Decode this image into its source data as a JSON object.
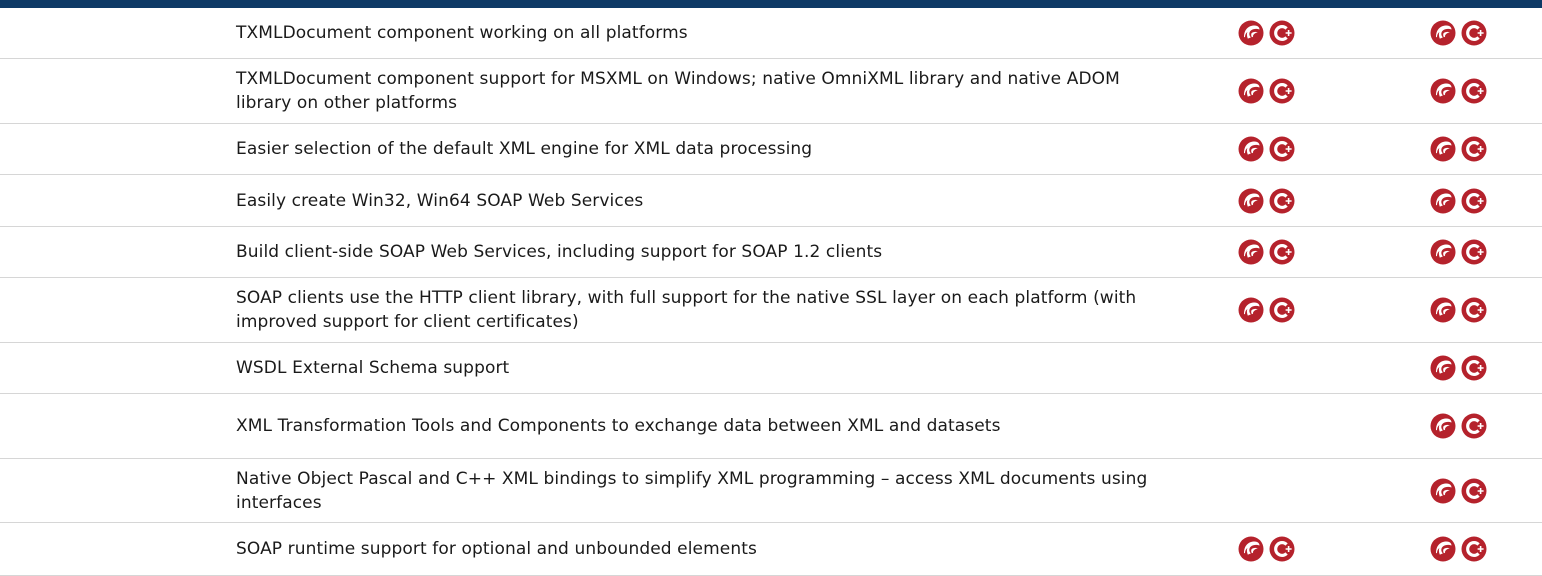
{
  "header": {
    "bar_color": "#0e3a66"
  },
  "icons": {
    "delphi": "delphi-helmet-icon",
    "cpp": "cpp-builder-icon",
    "color": "#b5222c"
  },
  "rows": [
    {
      "text": "TXMLDocument component working on all platforms",
      "col1": true,
      "col2": true
    },
    {
      "text": "TXMLDocument component support for MSXML on Windows; native OmniXML library and native ADOM library on other platforms",
      "col1": true,
      "col2": true
    },
    {
      "text": "Easier selection of the default XML engine for XML data processing",
      "col1": true,
      "col2": true
    },
    {
      "text": "Easily create Win32, Win64 SOAP Web Services",
      "col1": true,
      "col2": true
    },
    {
      "text": "Build client-side SOAP Web Services, including support for SOAP 1.2 clients",
      "col1": true,
      "col2": true
    },
    {
      "text": "SOAP clients use the HTTP client library, with full support for the native SSL layer on each platform (with improved support for client certificates)",
      "col1": true,
      "col2": true
    },
    {
      "text": "WSDL External Schema support",
      "col1": false,
      "col2": true
    },
    {
      "text": "XML Transformation Tools and Components to exchange data between XML and datasets",
      "col1": false,
      "col2": true
    },
    {
      "text": "Native Object Pascal and C++ XML bindings to simplify XML programming – access XML documents using interfaces",
      "col1": false,
      "col2": true
    },
    {
      "text": "SOAP runtime support for optional and unbounded elements",
      "col1": true,
      "col2": true
    }
  ]
}
